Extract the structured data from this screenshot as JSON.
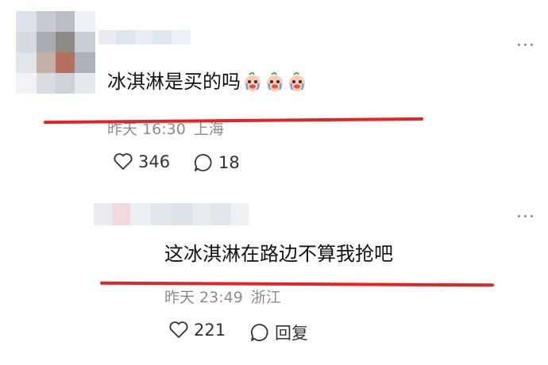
{
  "comment1": {
    "text": "冰淇淋是买的吗",
    "emojis": [
      "crying-face-icon",
      "crying-face-icon",
      "crying-face-icon"
    ],
    "time": "昨天 16:30",
    "location": "上海",
    "likes": "346",
    "comments": "18"
  },
  "comment2": {
    "text": "这冰淇淋在路边不算我抢吧",
    "time": "昨天 23:49",
    "location": "浙江",
    "likes": "221",
    "reply_label": "回复"
  },
  "colors": {
    "highlight": "#e52323",
    "meta_text": "#8c8c8c",
    "main_text": "#111111"
  }
}
